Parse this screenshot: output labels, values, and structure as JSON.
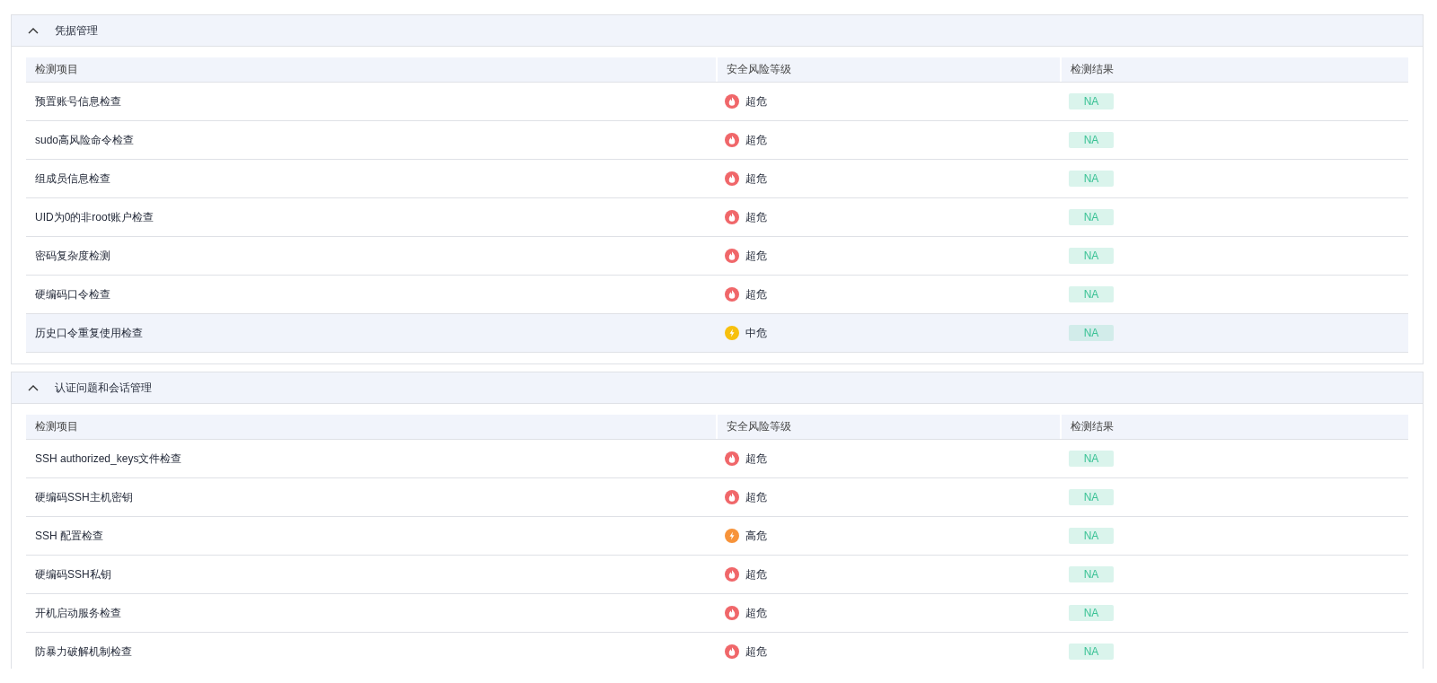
{
  "sections": [
    {
      "title": "凭据管理",
      "expanded": true,
      "columns": [
        "检测项目",
        "安全风险等级",
        "检测结果"
      ],
      "rows": [
        {
          "item": "预置账号信息检查",
          "kind": "critical",
          "risk": "超危",
          "result": "NA",
          "selected": false
        },
        {
          "item": "sudo高风险命令检查",
          "kind": "critical",
          "risk": "超危",
          "result": "NA",
          "selected": false
        },
        {
          "item": "组成员信息检查",
          "kind": "critical",
          "risk": "超危",
          "result": "NA",
          "selected": false
        },
        {
          "item": "UID为0的非root账户检查",
          "kind": "critical",
          "risk": "超危",
          "result": "NA",
          "selected": false
        },
        {
          "item": "密码复杂度检测",
          "kind": "critical",
          "risk": "超危",
          "result": "NA",
          "selected": false
        },
        {
          "item": "硬编码口令检查",
          "kind": "critical",
          "risk": "超危",
          "result": "NA",
          "selected": false
        },
        {
          "item": "历史口令重复使用检查",
          "kind": "medium",
          "risk": "中危",
          "result": "NA",
          "selected": true
        }
      ]
    },
    {
      "title": "认证问题和会话管理",
      "expanded": true,
      "columns": [
        "检测项目",
        "安全风险等级",
        "检测结果"
      ],
      "rows": [
        {
          "item": "SSH authorized_keys文件检查",
          "kind": "critical",
          "risk": "超危",
          "result": "NA",
          "selected": false
        },
        {
          "item": "硬编码SSH主机密钥",
          "kind": "critical",
          "risk": "超危",
          "result": "NA",
          "selected": false
        },
        {
          "item": "SSH 配置检查",
          "kind": "high",
          "risk": "高危",
          "result": "NA",
          "selected": false
        },
        {
          "item": "硬编码SSH私钥",
          "kind": "critical",
          "risk": "超危",
          "result": "NA",
          "selected": false
        },
        {
          "item": "开机启动服务检查",
          "kind": "critical",
          "risk": "超危",
          "result": "NA",
          "selected": false
        },
        {
          "item": "防暴力破解机制检查",
          "kind": "critical",
          "risk": "超危",
          "result": "NA",
          "selected": false
        }
      ]
    }
  ]
}
